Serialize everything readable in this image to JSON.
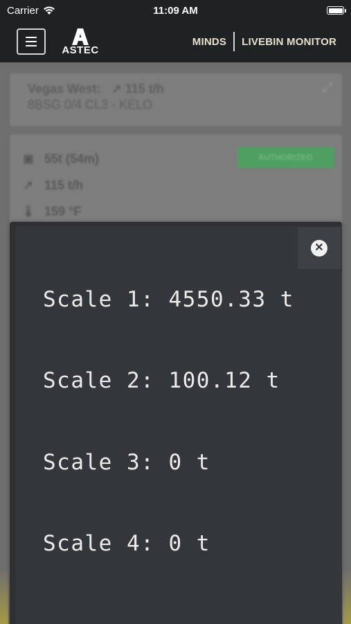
{
  "status_bar": {
    "carrier": "Carrier",
    "time": "11:09 AM"
  },
  "header": {
    "logo_text": "ASTEC",
    "links": [
      "MINDS",
      "LIVEBIN MONITOR"
    ]
  },
  "background": {
    "site_card": {
      "site_label": "Vegas West:",
      "rate": "115 t/h",
      "product": "8BSG 0/4 CL3 - KELO"
    },
    "stats_card": {
      "weight": "55t (54m)",
      "rate": "115 t/h",
      "temperature": "159 °F",
      "status_badge": "AUTHORIZED"
    }
  },
  "modal": {
    "scales": [
      "Scale 1: 4550.33 t",
      "Scale 2: 100.12 t",
      "Scale 3: 0 t",
      "Scale 4: 0 t"
    ]
  },
  "colors": {
    "header_bg": "#202123",
    "modal_bg": "#33363a",
    "badge_green": "#4f9f61"
  }
}
